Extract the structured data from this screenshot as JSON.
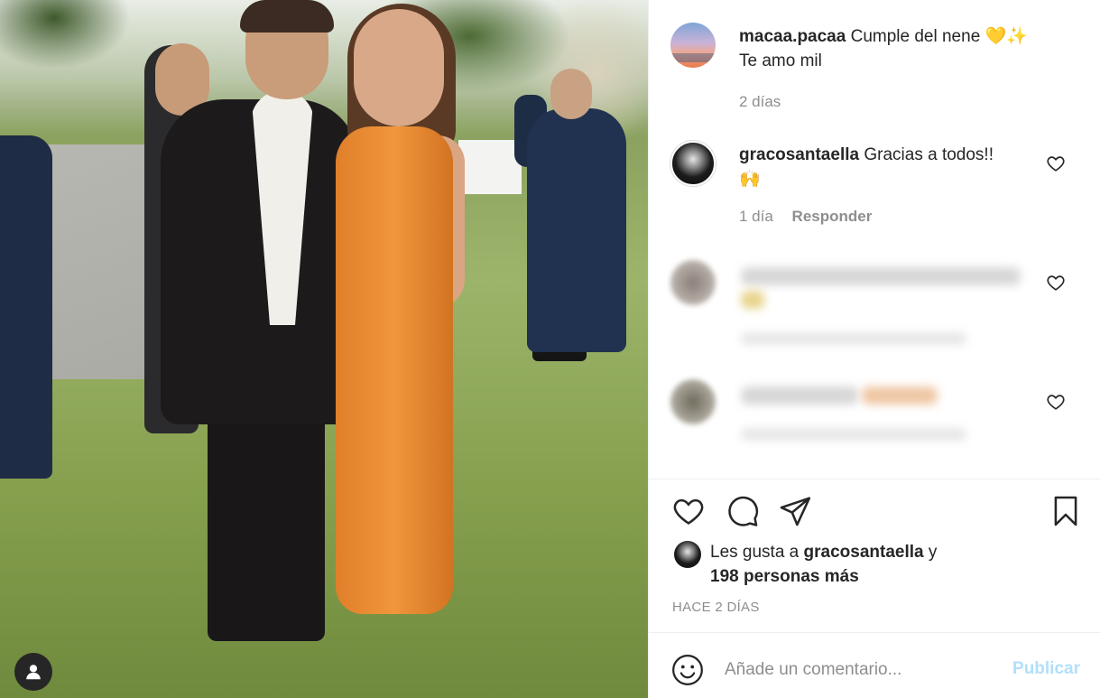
{
  "post": {
    "caption": {
      "username": "macaa.pacaa",
      "text": "Cumple del nene 💛✨",
      "text_line2": "Te amo mil",
      "age": "2 días"
    },
    "comments": [
      {
        "username": "gracosantaella",
        "text": "Gracias a todos!!",
        "emoji": "🙌",
        "age": "1 día",
        "reply_label": "Responder"
      }
    ],
    "likes": {
      "prefix": "Les gusta a",
      "user": "gracosantaella",
      "conjunction": "y",
      "others": "198 personas más"
    },
    "timestamp": "HACE 2 DÍAS",
    "add_comment": {
      "placeholder": "Añade un comentario...",
      "publish_label": "Publicar"
    }
  },
  "icons": {
    "like": "heart-icon",
    "comment": "comment-icon",
    "share": "paper-plane-icon",
    "save": "bookmark-icon",
    "emoji": "smiley-icon",
    "user_tag": "user-tag-icon"
  },
  "colors": {
    "text": "#262626",
    "secondary": "#8e8e8e",
    "publish_disabled": "#b2dffc",
    "border": "#efefef"
  }
}
